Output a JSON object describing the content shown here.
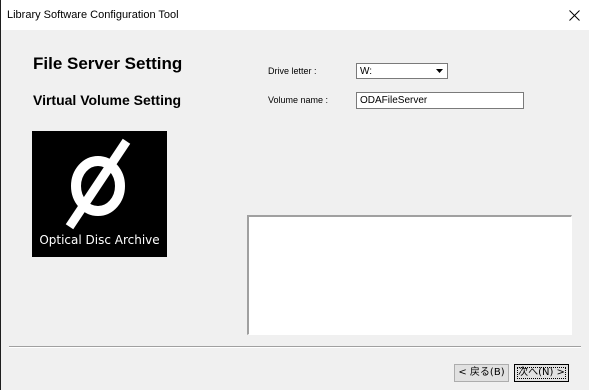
{
  "window": {
    "title": "Library Software Configuration Tool"
  },
  "content": {
    "heading": "File Server Setting",
    "subheading": "Virtual Volume Setting",
    "logo_text": "Optical Disc Archive"
  },
  "form": {
    "drive_letter_label": "Drive letter :",
    "drive_letter_value": "W:",
    "volume_name_label": "Volume name :",
    "volume_name_value": "ODAFileServer"
  },
  "buttons": {
    "back": "< 戻る(B)",
    "next": "次へ(N) >"
  },
  "icons": {
    "close": "close-icon",
    "dropdown": "chevron-down-icon",
    "logo": "optical-disc-archive-logo"
  }
}
